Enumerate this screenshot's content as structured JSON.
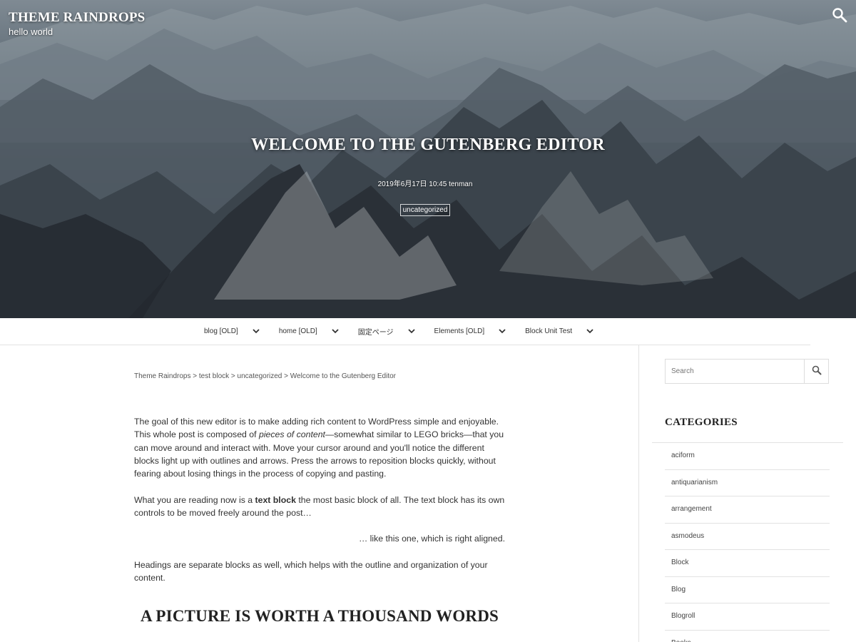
{
  "header": {
    "site_title": "THEME RAINDROPS",
    "site_description": "hello world",
    "search_icon": "search-icon"
  },
  "hero": {
    "post_title": "WELCOME TO THE GUTENBERG EDITOR",
    "post_meta": "2019年6月17日 10:45 tenman",
    "category_badge": "uncategorized"
  },
  "nav": {
    "items": [
      {
        "label": "blog [OLD]",
        "icon": "chevron-down-icon"
      },
      {
        "label": "home [OLD]",
        "icon": "chevron-down-icon"
      },
      {
        "label": "固定ページ",
        "icon": "chevron-down-icon"
      },
      {
        "label": "Elements [OLD]",
        "icon": "chevron-down-icon"
      },
      {
        "label": "Block Unit Test",
        "icon": "chevron-down-icon"
      }
    ]
  },
  "breadcrumb": {
    "items": [
      "Theme Raindrops",
      "test block",
      "uncategorized"
    ],
    "separator": ">",
    "current": "Welcome to the Gutenberg Editor"
  },
  "content": {
    "p1_before": "The goal of this new editor is to make adding rich content to WordPress simple and enjoyable. This whole post is composed of ",
    "p1_em": "pieces of content",
    "p1_after": "—somewhat similar to LEGO bricks—that you can move around and interact with. Move your cursor around and you'll notice the different blocks light up with outlines and arrows. Press the arrows to reposition blocks quickly, without fearing about losing things in the process of copying and pasting.",
    "p2_before": "What you are reading now is a ",
    "p2_strong": "text block",
    "p2_after": " the most basic block of all. The text block has its own controls to be moved freely around the post…",
    "p3": "… like this one, which is right aligned.",
    "p4": "Headings are separate blocks as well, which helps with the outline and organization of your content.",
    "h2": "A PICTURE IS WORTH A THOUSAND WORDS"
  },
  "sidebar": {
    "search_placeholder": "Search",
    "search_button_icon": "search-icon",
    "categories_title": "CATEGORIES",
    "categories": [
      "aciform",
      "antiquarianism",
      "arrangement",
      "asmodeus",
      "Block",
      "Blog",
      "Blogroll",
      "Books"
    ]
  },
  "colors": {
    "hero_dark": "#262c33",
    "hero_light": "#7f8a93",
    "text": "#333333",
    "border": "#e2e2e2"
  }
}
